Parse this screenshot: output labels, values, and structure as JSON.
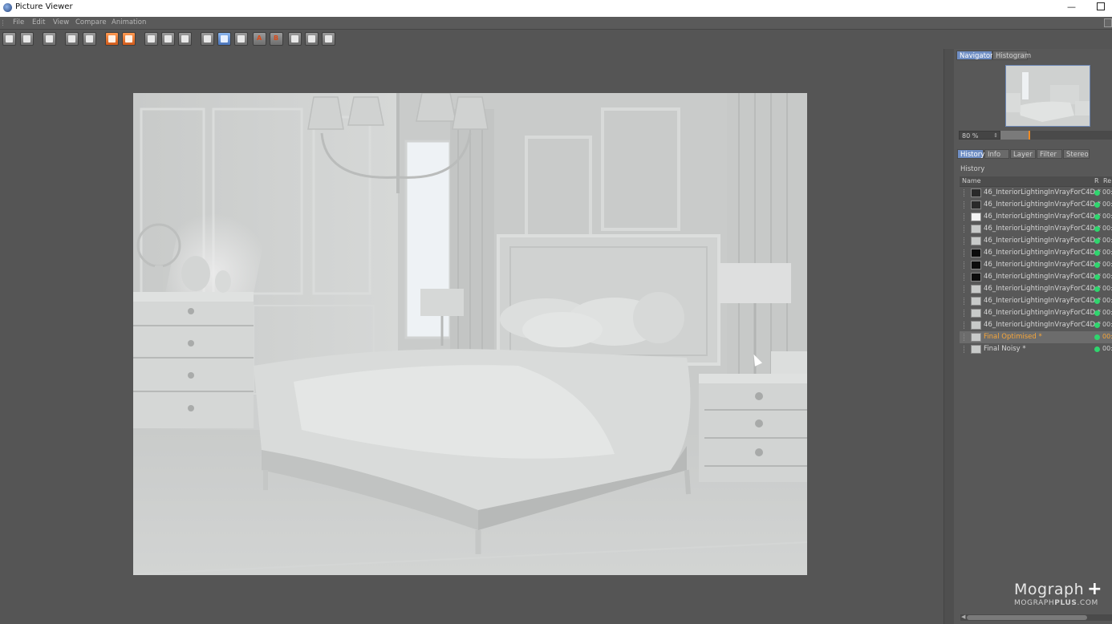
{
  "window": {
    "title": "Picture Viewer"
  },
  "menu": {
    "items": [
      "File",
      "Edit",
      "View",
      "Compare",
      "Animation"
    ]
  },
  "navigator": {
    "tabs": [
      "Navigator",
      "Histogram"
    ],
    "active_tab": "Navigator",
    "zoom_value": "80 %",
    "zoom_level": 0.25
  },
  "history": {
    "tabs": [
      "History",
      "Info",
      "Layer",
      "Filter",
      "Stereo"
    ],
    "active_tab": "History",
    "section_label": "History",
    "columns": {
      "name": "Name",
      "r": "R",
      "re": "Re"
    },
    "rows": [
      {
        "name": "46_InteriorLightingInVrayForC4D *",
        "r": "00:",
        "thumb": "dark"
      },
      {
        "name": "46_InteriorLightingInVrayForC4D *",
        "r": "00:",
        "thumb": "dark"
      },
      {
        "name": "46_InteriorLightingInVrayForC4D *",
        "r": "00:",
        "thumb": "white"
      },
      {
        "name": "46_InteriorLightingInVrayForC4D *",
        "r": "00:",
        "thumb": "render"
      },
      {
        "name": "46_InteriorLightingInVrayForC4D *",
        "r": "00:",
        "thumb": "render"
      },
      {
        "name": "46_InteriorLightingInVrayForC4D *",
        "r": "00:",
        "thumb": "black"
      },
      {
        "name": "46_InteriorLightingInVrayForC4D *",
        "r": "00:",
        "thumb": "black"
      },
      {
        "name": "46_InteriorLightingInVrayForC4D *",
        "r": "00:",
        "thumb": "black"
      },
      {
        "name": "46_InteriorLightingInVrayForC4D *",
        "r": "00:",
        "thumb": "render"
      },
      {
        "name": "46_InteriorLightingInVrayForC4D *",
        "r": "00:",
        "thumb": "render"
      },
      {
        "name": "46_InteriorLightingInVrayForC4D *",
        "r": "00:",
        "thumb": "render"
      },
      {
        "name": "46_InteriorLightingInVrayForC4D *",
        "r": "00:",
        "thumb": "render"
      },
      {
        "name": "Final Optimised *",
        "r": "00:",
        "thumb": "render",
        "selected": true
      },
      {
        "name": "Final Noisy *",
        "r": "00:",
        "thumb": "render"
      }
    ]
  },
  "watermark": {
    "brand": "Mograph",
    "url_prefix": "MOGRAPH",
    "url_bold": "PLUS",
    "url_suffix": ".COM"
  },
  "toolbar": {
    "buttons": [
      "open-icon",
      "save-icon",
      "render-settings-icon",
      "region-icon",
      "export-icon",
      "copy-icon",
      "paste-icon",
      "view-icon",
      "compare-icon",
      "ab-icon",
      "channel-icon",
      "channel-icon",
      "channel-icon",
      "a-icon",
      "b-icon",
      "swap-icon",
      "split-icon",
      "fit-icon"
    ],
    "a_label": "A",
    "b_label": "B"
  },
  "colors": {
    "accent_blue": "#6f8ec4",
    "selection_orange": "#f5a53a",
    "status_green": "#2fd56e"
  }
}
